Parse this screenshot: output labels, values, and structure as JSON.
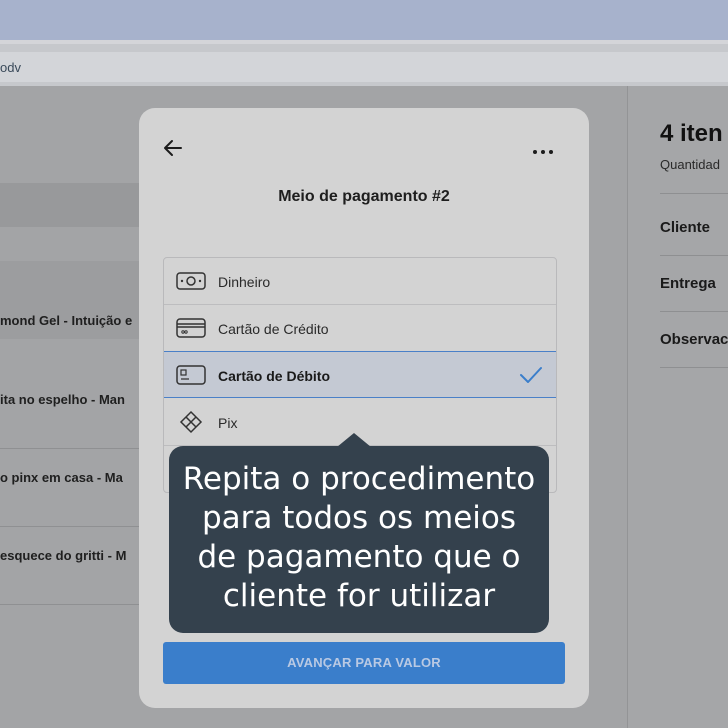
{
  "browser": {
    "url_fragment": "odv"
  },
  "background_list": {
    "rows": [
      "mond Gel - Intuição e",
      "ita no espelho - Man",
      "o pinx em casa - Ma",
      "esquece do gritti - M"
    ]
  },
  "right_panel": {
    "title": "4 iten",
    "subtitle": "Quantidad",
    "items": [
      "Cliente",
      "Entrega",
      "Observac"
    ]
  },
  "modal": {
    "title": "Meio de pagamento #2",
    "back_icon": "arrow-left-icon",
    "more_icon": "more-horizontal-icon",
    "options": [
      {
        "label": "Dinheiro",
        "icon": "cash-icon",
        "selected": false
      },
      {
        "label": "Cartão de Crédito",
        "icon": "credit-card-icon",
        "selected": false
      },
      {
        "label": "Cartão de Débito",
        "icon": "debit-card-icon",
        "selected": true
      },
      {
        "label": "Pix",
        "icon": "pix-icon",
        "selected": false
      }
    ],
    "cta_label": "AVANÇAR PARA VALOR"
  },
  "tooltip": {
    "lines": [
      "Repita o procedimento",
      "para todos os meios",
      "de pagamento que o",
      "cliente for utilizar"
    ]
  },
  "colors": {
    "accent": "#3a7ecb",
    "tooltip_bg": "#34414d",
    "selected_border": "#4a80c8"
  }
}
